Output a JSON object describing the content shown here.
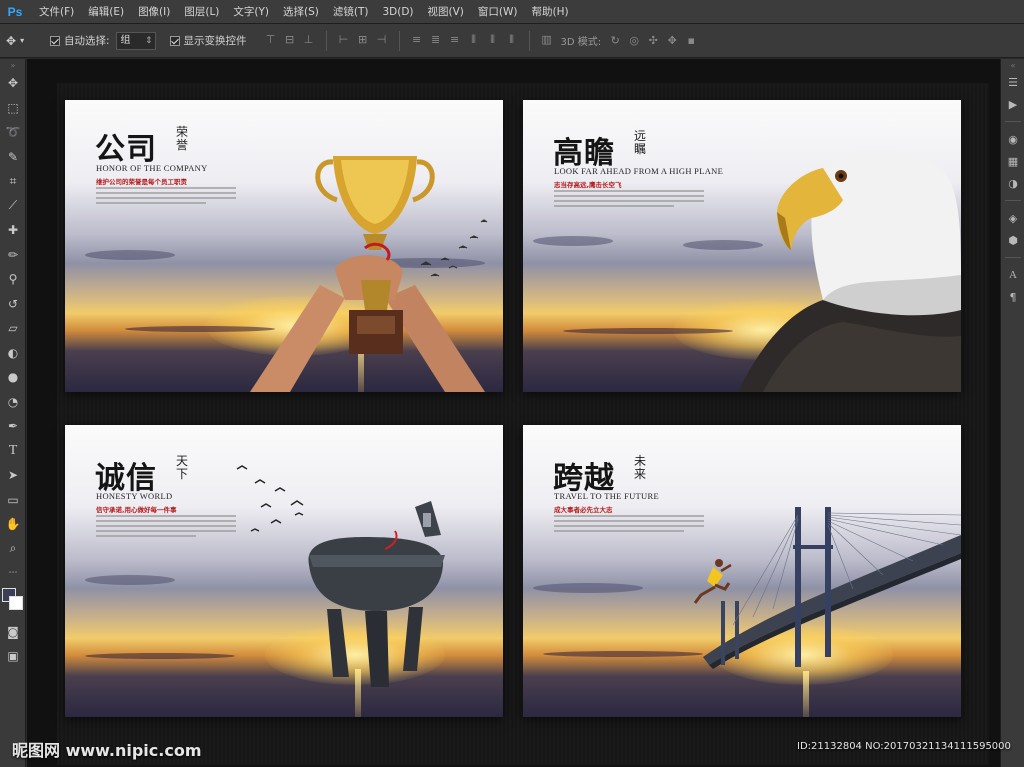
{
  "app": {
    "logo": "Ps"
  },
  "menu": [
    "文件(F)",
    "编辑(E)",
    "图像(I)",
    "图层(L)",
    "文字(Y)",
    "选择(S)",
    "滤镜(T)",
    "3D(D)",
    "视图(V)",
    "窗口(W)",
    "帮助(H)"
  ],
  "options": {
    "auto_select_label": "自动选择:",
    "auto_select_value": "组",
    "show_transform_label": "显示变换控件",
    "mode_label": "3D 模式:"
  },
  "colors": {
    "foreground": "#3a3f57",
    "background": "#ffffff"
  },
  "posters": [
    {
      "title": "公司",
      "side": "荣誉",
      "subtitle_en": "HONOR OF THE COMPANY",
      "subtitle_cn": "维护公司的荣誉是每个员工职责",
      "subject": "trophy"
    },
    {
      "title": "高瞻",
      "side": "远瞩",
      "subtitle_en": "LOOK FAR AHEAD FROM A HIGH PLANE",
      "subtitle_cn": "志当存高远,鹰击长空飞",
      "subject": "eagle"
    },
    {
      "title": "诚信",
      "side": "天下",
      "subtitle_en": "HONESTY WORLD",
      "subtitle_cn": "信守承诺,用心做好每一件事",
      "subject": "bronze-ding"
    },
    {
      "title": "跨越",
      "side": "未来",
      "subtitle_en": "TRAVEL TO THE FUTURE",
      "subtitle_cn": "成大事者必先立大志",
      "subject": "bridge-runner"
    }
  ],
  "watermark": {
    "site": "昵图网 www.nipic.com",
    "id": "ID:21132804 NO:20170321134111595000"
  }
}
